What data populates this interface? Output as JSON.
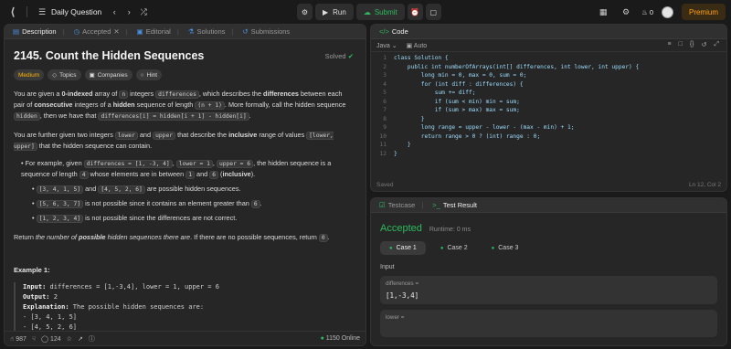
{
  "topbar": {
    "problem_list_label": "Daily Question",
    "run_label": "Run",
    "submit_label": "Submit",
    "streak_count": "0",
    "premium_label": "Premium"
  },
  "left_tabs": [
    {
      "label": "Description"
    },
    {
      "label": "Accepted"
    },
    {
      "label": "Editorial"
    },
    {
      "label": "Solutions"
    },
    {
      "label": "Submissions"
    }
  ],
  "problem": {
    "title": "2145. Count the Hidden Sequences",
    "status": "Solved",
    "difficulty": "Medium",
    "topics_label": "Topics",
    "companies_label": "Companies",
    "hint_label": "Hint"
  },
  "description": {
    "p1": {
      "a": "You are given a ",
      "b": "0-indexed",
      "c": " array of ",
      "d": "n",
      "e": " integers ",
      "f": "differences",
      "g": ", which describes the ",
      "h": "differences",
      "i": " between each pair of ",
      "j": "consecutive",
      "k": " integers of a ",
      "l": "hidden",
      "m": " sequence of length ",
      "n": "(n + 1)",
      "o": ". More formally, call the hidden sequence ",
      "p": "hidden",
      "q": ", then we have that ",
      "r": "differences[i] = hidden[i + 1] - hidden[i]",
      "s": "."
    },
    "p2": {
      "a": "You are further given two integers ",
      "b": "lower",
      "c": " and ",
      "d": "upper",
      "e": " that describe the ",
      "f": "inclusive",
      "g": " range of values ",
      "h": "[lower, upper]",
      "i": " that the hidden sequence can contain."
    },
    "bullet": {
      "a": "For example, given ",
      "b": "differences = [1, -3, 4]",
      "c": ", ",
      "d": "lower = 1",
      "e": ", ",
      "f": "upper = 6",
      "g": ", the hidden sequence is a sequence of length ",
      "h": "4",
      "i": " whose elements are in between ",
      "j": "1",
      "k": " and ",
      "l": "6",
      "m": " (",
      "n": "inclusive",
      "o": ")."
    },
    "sub1": {
      "a": "[3, 4, 1, 5]",
      "b": " and ",
      "c": "[4, 5, 2, 6]",
      "d": " are possible hidden sequences."
    },
    "sub2": {
      "a": "[5, 6, 3, 7]",
      "b": " is not possible since it contains an element greater than ",
      "c": "6",
      "d": "."
    },
    "sub3": {
      "a": "[1, 2, 3, 4]",
      "b": " is not possible since the differences are not correct."
    },
    "p3": {
      "a": "Return ",
      "b": "the number of ",
      "c": "possible",
      "d": " hidden sequences there are",
      "e": ". If there are no possible sequences, return ",
      "f": "0",
      "g": "."
    },
    "example_title": "Example 1:",
    "ex_input_label": "Input:",
    "ex_input": " differences = [1,-3,4], lower = 1, upper = 6",
    "ex_output_label": "Output:",
    "ex_output": " 2",
    "ex_expl_label": "Explanation:",
    "ex_expl": " The possible hidden sequences are:",
    "ex_line1": "- [3, 4, 1, 5]",
    "ex_line2": "- [4, 5, 2, 6]"
  },
  "footer": {
    "likes": "987",
    "comments": "124",
    "online": "1150 Online"
  },
  "code_panel": {
    "tab_label": "Code",
    "language": "Java",
    "auto_label": "Auto",
    "lines": [
      "class Solution {",
      "    public int numberOfArrays(int[] differences, int lower, int upper) {",
      "        long min = 0, max = 0, sum = 0;",
      "        for (int diff : differences) {",
      "            sum += diff;",
      "            if (sum < min) min = sum;",
      "            if (sum > max) max = sum;",
      "        }",
      "        long range = upper - lower - (max - min) + 1;",
      "        return range > 0 ? (int) range : 0;",
      "    }",
      "}"
    ],
    "saved_label": "Saved",
    "cursor_position": "Ln 12, Col 2"
  },
  "test_panel": {
    "testcase_tab": "Testcase",
    "result_tab": "Test Result",
    "status": "Accepted",
    "runtime": "Runtime: 0 ms",
    "cases": [
      "Case 1",
      "Case 2",
      "Case 3"
    ],
    "input_label": "Input",
    "param1_name": "differences =",
    "param1_value": "[1,-3,4]",
    "param2_name": "lower ="
  },
  "colors": {
    "accent_green": "#2cbb5d",
    "medium_yellow": "#ffb800",
    "premium_orange": "#ffa116"
  }
}
